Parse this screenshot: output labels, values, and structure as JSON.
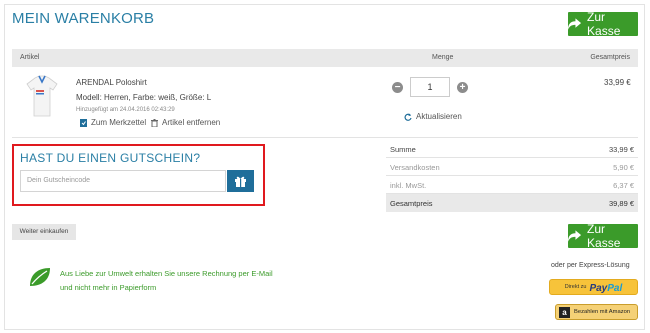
{
  "page": {
    "title": "MEIN WARENKORB",
    "checkout_label": "Zur Kasse"
  },
  "table": {
    "col_article": "Artikel",
    "col_qty": "Menge",
    "col_total": "Gesamtpreis"
  },
  "item": {
    "name": "ARENDAL Poloshirt",
    "details": "Modell: Herren, Farbe: weiß, Größe: L",
    "added": "Hinzugefügt am 24.04.2016 02:43:29",
    "wishlist_label": "Zum Merkzettel",
    "remove_label": "Artikel entfernen",
    "quantity": "1",
    "refresh_label": "Aktualisieren",
    "price": "33,99 €"
  },
  "voucher": {
    "title": "HAST DU EINEN GUTSCHEIN?",
    "placeholder": "Dein Gutscheincode"
  },
  "summary": {
    "sum_label": "Summe",
    "sum_value": "33,99 €",
    "shipping_label": "Versandkosten",
    "shipping_value": "5,90 €",
    "vat_label": "inkl. MwSt.",
    "vat_value": "6,37 €",
    "total_label": "Gesamtpreis",
    "total_value": "39,89 €"
  },
  "footer": {
    "continue_label": "Weiter einkaufen",
    "eco_line1": "Aus Liebe zur Umwelt erhalten Sie unsere Rechnung per E-Mail",
    "eco_line2": "und nicht mehr in Papierform",
    "express_label": "oder per Express-Lösung",
    "paypal_small": "Direkt zu",
    "paypal_pay": "Pay",
    "paypal_pal": "Pal",
    "amazon_label": "Bezahlen mit Amazon"
  },
  "colors": {
    "accent": "#2a7fa5",
    "checkout_green": "#3b9b2a",
    "highlight_red": "#e0191e",
    "gift_button": "#1f6e9a"
  }
}
